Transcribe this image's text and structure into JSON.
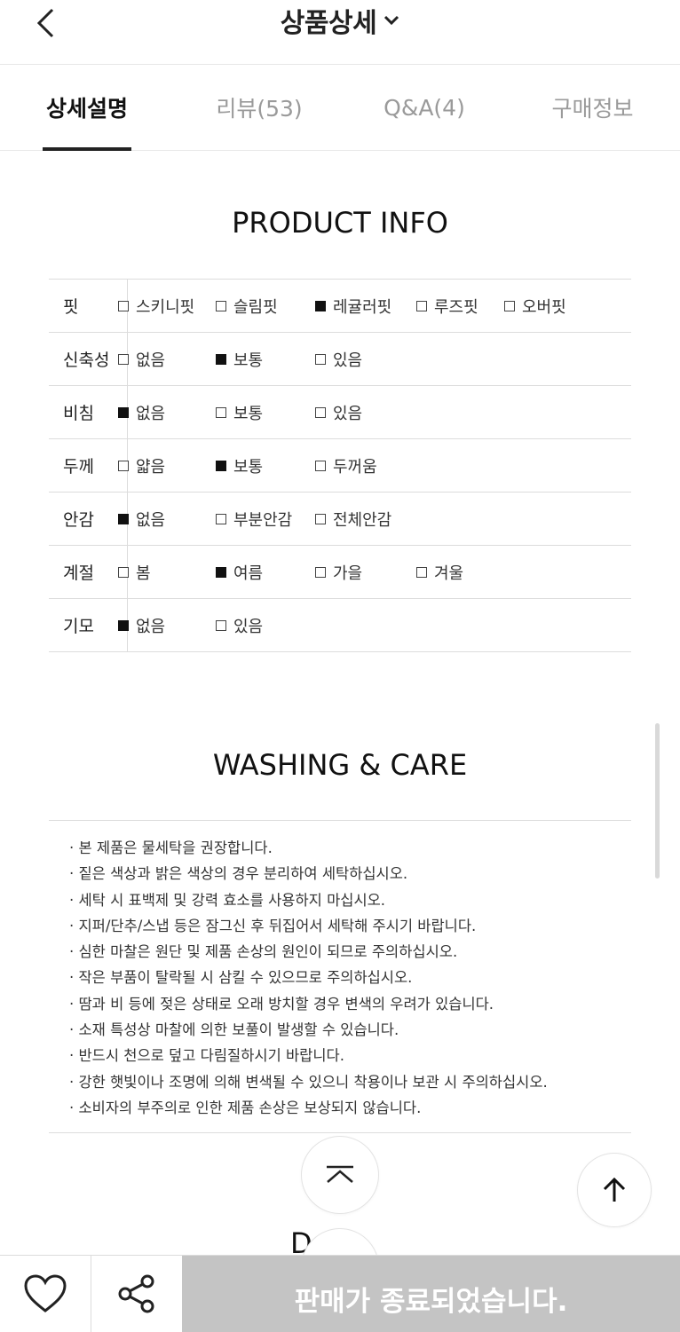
{
  "header": {
    "title": "상품상세",
    "back_icon": "chevron-left-icon",
    "title_dropdown_icon": "chevron-down-icon"
  },
  "tabs": [
    {
      "label": "상세설명",
      "active": true
    },
    {
      "label": "리뷰(53)",
      "active": false
    },
    {
      "label": "Q&A(4)",
      "active": false
    },
    {
      "label": "구매정보",
      "active": false
    }
  ],
  "product_info": {
    "title": "PRODUCT INFO",
    "rows": [
      {
        "label": "핏",
        "options": [
          {
            "text": "스키니핏",
            "checked": false
          },
          {
            "text": "슬림핏",
            "checked": false
          },
          {
            "text": "레귤러핏",
            "checked": true
          },
          {
            "text": "루즈핏",
            "checked": false
          },
          {
            "text": "오버핏",
            "checked": false
          }
        ]
      },
      {
        "label": "신축성",
        "options": [
          {
            "text": "없음",
            "checked": false
          },
          {
            "text": "보통",
            "checked": true
          },
          {
            "text": "있음",
            "checked": false
          }
        ]
      },
      {
        "label": "비침",
        "options": [
          {
            "text": "없음",
            "checked": true
          },
          {
            "text": "보통",
            "checked": false
          },
          {
            "text": "있음",
            "checked": false
          }
        ]
      },
      {
        "label": "두께",
        "options": [
          {
            "text": "얇음",
            "checked": false
          },
          {
            "text": "보통",
            "checked": true
          },
          {
            "text": "두꺼움",
            "checked": false
          }
        ]
      },
      {
        "label": "안감",
        "options": [
          {
            "text": "없음",
            "checked": true
          },
          {
            "text": "부분안감",
            "checked": false
          },
          {
            "text": "전체안감",
            "checked": false
          }
        ]
      },
      {
        "label": "계절",
        "options": [
          {
            "text": "봄",
            "checked": false
          },
          {
            "text": "여름",
            "checked": true
          },
          {
            "text": "가을",
            "checked": false
          },
          {
            "text": "겨울",
            "checked": false
          }
        ]
      },
      {
        "label": "기모",
        "options": [
          {
            "text": "없음",
            "checked": true
          },
          {
            "text": "있음",
            "checked": false
          }
        ]
      }
    ]
  },
  "washing_care": {
    "title": "WASHING & CARE",
    "items": [
      "· 본 제품은 물세탁을 권장합니다.",
      "· 짙은 색상과 밝은 색상의 경우 분리하여 세탁하십시오.",
      "· 세탁 시 표백제 및 강력 효소를 사용하지 마십시오.",
      "· 지퍼/단추/스냅 등은 잠그신 후 뒤집어서 세탁해 주시기 바랍니다.",
      "· 심한 마찰은 원단 및 제품 손상의 원인이 되므로 주의하십시오.",
      "· 작은 부품이 탈락될 시 삼킬 수 있으므로 주의하십시오.",
      "· 땀과 비 등에 젖은 상태로 오래 방치할 경우 변색의 우려가 있습니다.",
      "· 소재 특성상 마찰에 의한 보풀이 발생할 수 있습니다.",
      "· 반드시 천으로 덮고 다림질하시기 바랍니다.",
      "· 강한 햇빛이나 조명에 의해 변색될 수 있으니 착용이나 보관 시 주의하십시오.",
      "· 소비자의 부주의로 인한 제품 손상은 보상되지 않습니다."
    ]
  },
  "next_section_peek": "D    L",
  "floating": {
    "scroll_top_icon": "arrow-up-icon",
    "section_up_icon": "double-chevron-up-icon",
    "section_down_icon": "chevron-down-underline-icon"
  },
  "bottom_bar": {
    "like_icon": "heart-icon",
    "share_icon": "share-icon",
    "status_label": "판매가 종료되었습니다.",
    "status_bg": "#c4c4c4"
  }
}
